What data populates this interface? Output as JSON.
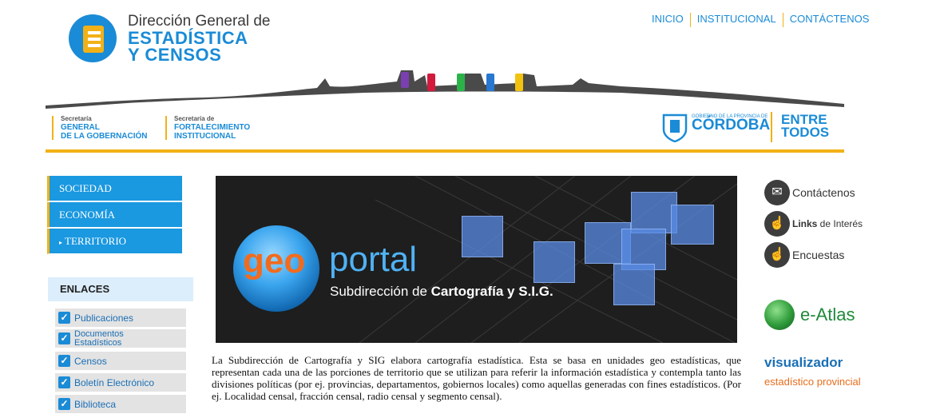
{
  "header": {
    "logo_line1": "Dirección General de",
    "logo_line2": "ESTADÍSTICA",
    "logo_line3": "Y CENSOS",
    "nav": [
      {
        "label": "INICIO"
      },
      {
        "label": "INSTITUCIONAL"
      },
      {
        "label": "CONTÁCTENOS"
      }
    ],
    "secretaria1": {
      "small": "Secretaría",
      "line1": "GENERAL",
      "line2": "DE LA GOBERNACIÓN"
    },
    "secretaria2": {
      "small": "Secretaría de",
      "line1": "FORTALECIMIENTO",
      "line2": "INSTITUCIONAL"
    },
    "gobierno_small": "GOBIERNO DE LA PROVINCIA DE",
    "cordoba": "CÓRDOBA",
    "entre1": "ENTRE",
    "entre2": "TODOS"
  },
  "sidebar": {
    "menu": [
      {
        "label": "SOCIEDAD"
      },
      {
        "label": "ECONOMÍA"
      },
      {
        "label": "TERRITORIO"
      }
    ],
    "enlaces_title": "ENLACES",
    "enlaces": [
      {
        "label": "Publicaciones"
      },
      {
        "label1": "Documentos",
        "label2": "Estadísticos"
      },
      {
        "label": "Censos"
      },
      {
        "label": "Boletín Electrónico"
      },
      {
        "label": "Biblioteca"
      }
    ]
  },
  "banner": {
    "geo": "geo",
    "portal": "portal",
    "subtitle_prefix": "Subdirección de ",
    "subtitle_bold": "Cartografía y S.I.G."
  },
  "description": "La Subdirección de Cartografía y SIG elabora cartografía estadística. Esta se basa en unidades geo estadísticas, que representan cada una de las porciones de territorio que se utilizan para referir la información estadística y contempla tanto las divisiones políticas (por ej. provincias, departamentos, gobiernos locales) como aquellas generadas con fines estadísticos. (Por ej. Localidad censal, fracción censal, radio censal y segmento censal).",
  "right": {
    "contact_label": "Contáctenos",
    "links_bold": "Links",
    "links_rest": " de Interés",
    "encuestas_label": "Encuestas",
    "atlas_label": "e-Atlas",
    "visualizador": "visualizador",
    "visualizador_sub": "estadístico provincial"
  },
  "colors": {
    "accent_blue": "#1a98e0",
    "accent_yellow": "#f2b117",
    "geo_orange": "#f26b1d"
  }
}
